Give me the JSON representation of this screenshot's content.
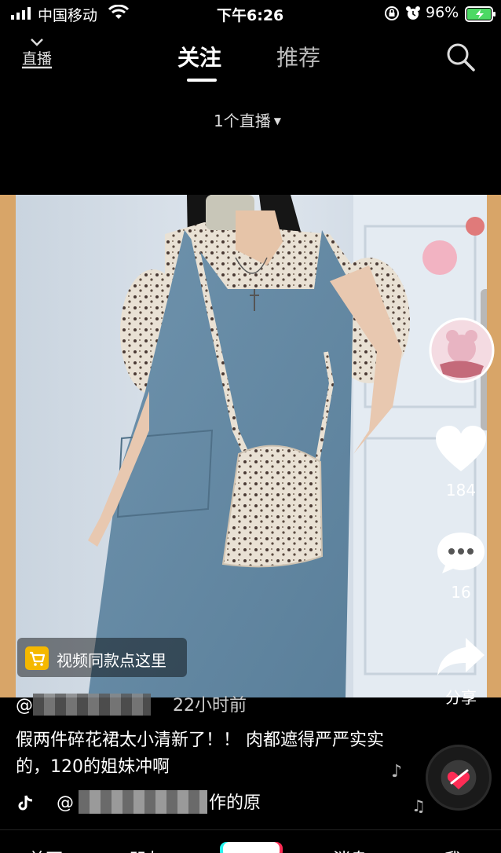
{
  "status_bar": {
    "carrier": "中国移动",
    "time": "下午6:26",
    "battery": "96%"
  },
  "top_nav": {
    "live_label": "直播",
    "tabs": [
      {
        "label": "关注",
        "active": true
      },
      {
        "label": "推荐",
        "active": false
      }
    ],
    "live_count": "1个直播"
  },
  "video": {
    "likes": "184",
    "comments": "16",
    "share_label": "分享",
    "product_tag": "视频同款点这里",
    "time_ago": "22小时前",
    "caption": "假两件碎花裙太小清新了！！ 肉都遮得严严实实的，120的姐妹冲啊",
    "music_prefix": "@",
    "music_suffix": "作的原",
    "author_prefix": "@"
  },
  "bottom_nav": {
    "items": [
      "首页",
      "朋友",
      "消息",
      "我"
    ]
  },
  "colors": {
    "background": "#000000",
    "accent_like": "#ffffff",
    "cart_badge": "#f5b800",
    "battery_green": "#4cd964",
    "brand_red": "#fe2c55",
    "brand_cyan": "#25f4ee"
  }
}
